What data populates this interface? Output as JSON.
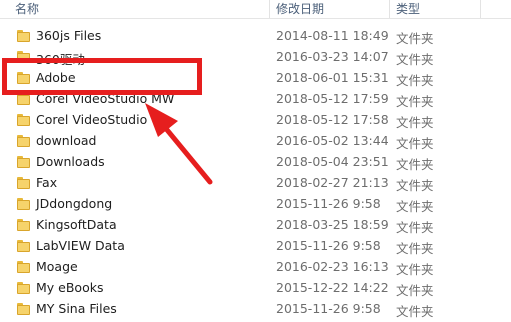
{
  "header": {
    "name_label": "名称",
    "date_label": "修改日期",
    "type_label": "类型"
  },
  "folder_color": "#f6d36b",
  "annotation_color": "#e61e1e",
  "rows": [
    {
      "name": "360js Files",
      "date": "2014-08-11 18:49",
      "type": "文件夹"
    },
    {
      "name": "360驱动",
      "date": "2016-03-23 14:07",
      "type": "文件夹"
    },
    {
      "name": "Adobe",
      "date": "2018-06-01 15:31",
      "type": "文件夹"
    },
    {
      "name": "Corel VideoStudio MW",
      "date": "2018-05-12 17:59",
      "type": "文件夹"
    },
    {
      "name": "Corel VideoStudio",
      "date": "2018-05-12 17:58",
      "type": "文件夹"
    },
    {
      "name": "download",
      "date": "2016-05-02 13:44",
      "type": "文件夹"
    },
    {
      "name": "Downloads",
      "date": "2018-05-04 23:51",
      "type": "文件夹"
    },
    {
      "name": "Fax",
      "date": "2018-02-27 21:13",
      "type": "文件夹"
    },
    {
      "name": "JDdongdong",
      "date": "2015-11-26 9:58",
      "type": "文件夹"
    },
    {
      "name": "KingsoftData",
      "date": "2018-03-25 18:59",
      "type": "文件夹"
    },
    {
      "name": "LabVIEW Data",
      "date": "2015-11-26 9:58",
      "type": "文件夹"
    },
    {
      "name": "Moage",
      "date": "2016-02-23 16:13",
      "type": "文件夹"
    },
    {
      "name": "My eBooks",
      "date": "2015-12-22 14:22",
      "type": "文件夹"
    },
    {
      "name": "MY Sina Files",
      "date": "2015-11-26 9:58",
      "type": "文件夹"
    }
  ]
}
